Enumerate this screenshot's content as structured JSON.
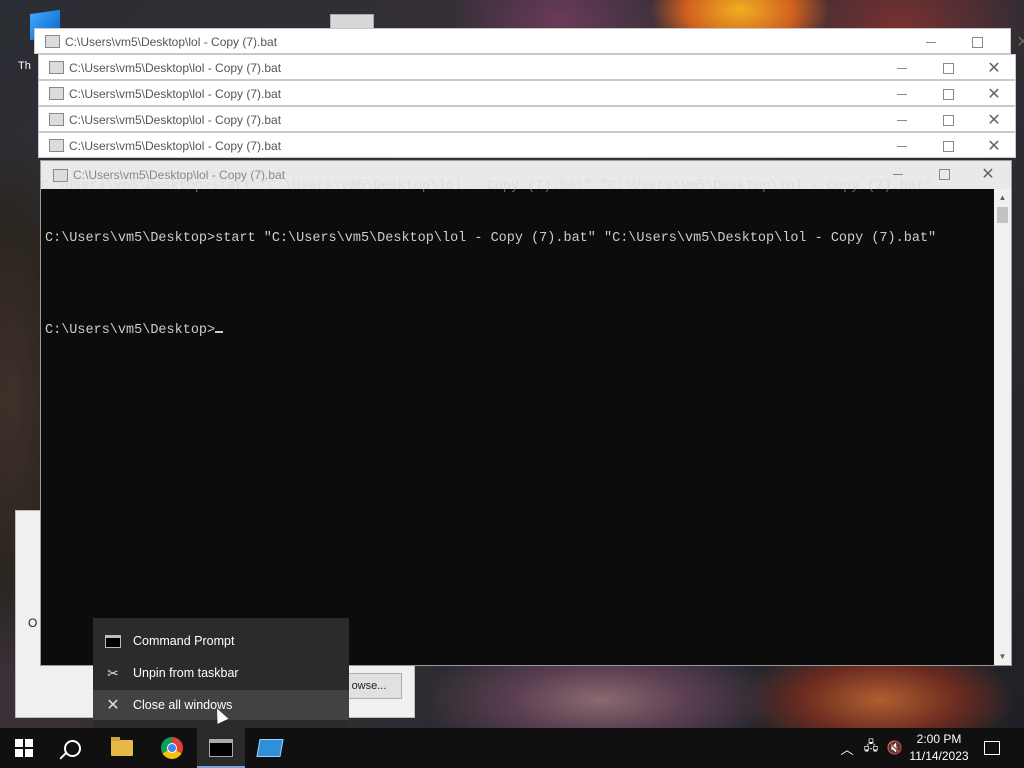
{
  "desktop": {
    "icon_label_partial": "Th",
    "dialog_label_partial": "O",
    "browse_button": "owse..."
  },
  "windows": {
    "title": "C:\\Users\\vm5\\Desktop\\lol - Copy (7).bat"
  },
  "console": {
    "ghost_line": "C:\\Users\\vm5\\Desktop>start \"C:\\Users\\vm5\\Desktop\\lol - Copy (7).bat\" \"C:\\Users\\vm5\\Desktop\\lol - Copy (7).bat\"",
    "line1": "C:\\Users\\vm5\\Desktop>start \"C:\\Users\\vm5\\Desktop\\lol - Copy (7).bat\" \"C:\\Users\\vm5\\Desktop\\lol - Copy (7).bat\"",
    "prompt": "C:\\Users\\vm5\\Desktop>"
  },
  "jump_list": {
    "items": [
      {
        "label": "Command Prompt",
        "icon": "cmd-icon"
      },
      {
        "label": "Unpin from taskbar",
        "icon": "unpin-icon"
      },
      {
        "label": "Close all windows",
        "icon": "close-icon"
      }
    ]
  },
  "taskbar": {
    "apps": [
      "start",
      "search",
      "file-explorer",
      "chrome",
      "command-prompt",
      "remote-desktop"
    ],
    "time": "2:00 PM",
    "date": "11/14/2023"
  },
  "colors": {
    "console_bg": "#0c0c0c",
    "console_text": "#cccccc",
    "menu_bg": "#2b2b2b",
    "taskbar_bg": "#101010",
    "taskbar_accent": "#7aa5d8"
  }
}
